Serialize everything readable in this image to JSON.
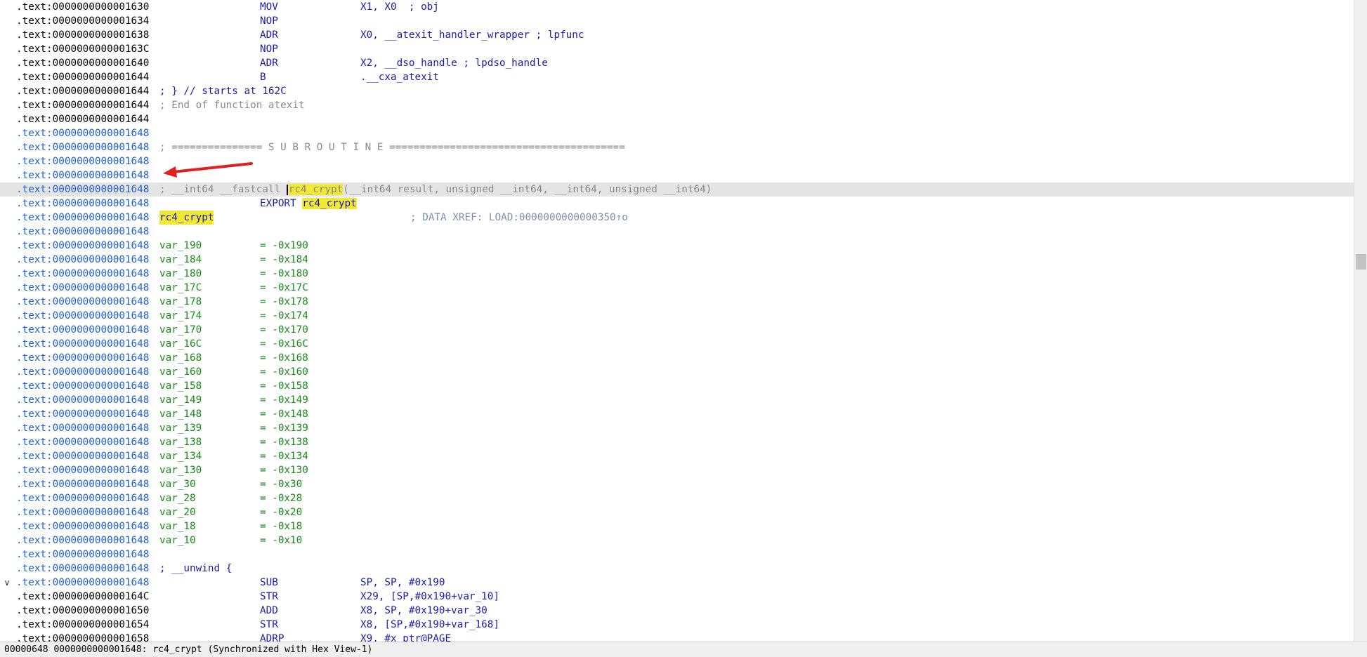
{
  "colors": {
    "background": "#ffffff",
    "address_black": "#000000",
    "address_blue": "#1f5fd6",
    "mnemonic": "#1b1bb0",
    "comment": "#8a8a8a",
    "variable": "#1a8a1a",
    "highlight": "#f0e832",
    "current_line": "#e4e4e4",
    "arrow": "#e02020"
  },
  "disasm": {
    "lines": [
      {
        "addr": ".text:0000000000001630",
        "addr_color": "black",
        "mnem": "MOV",
        "ops": "X1, X0  ; obj"
      },
      {
        "addr": ".text:0000000000001634",
        "addr_color": "black",
        "mnem": "NOP",
        "ops": ""
      },
      {
        "addr": ".text:0000000000001638",
        "addr_color": "black",
        "mnem": "ADR",
        "ops": "X0, __atexit_handler_wrapper ; lpfunc"
      },
      {
        "addr": ".text:000000000000163C",
        "addr_color": "black",
        "mnem": "NOP",
        "ops": ""
      },
      {
        "addr": ".text:0000000000001640",
        "addr_color": "black",
        "mnem": "ADR",
        "ops": "X2, __dso_handle ; lpdso_handle"
      },
      {
        "addr": ".text:0000000000001644",
        "addr_color": "black",
        "mnem": "B",
        "ops": ".__cxa_atexit"
      },
      {
        "addr": ".text:0000000000001644",
        "addr_color": "black",
        "comment_blue": "; } // starts at 162C"
      },
      {
        "addr": ".text:0000000000001644",
        "addr_color": "black",
        "comment": "; End of function atexit"
      },
      {
        "addr": ".text:0000000000001644",
        "addr_color": "black"
      },
      {
        "addr": ".text:0000000000001648",
        "addr_color": "blue"
      },
      {
        "addr": ".text:0000000000001648",
        "addr_color": "blue",
        "comment": "; =============== S U B R O U T I N E ======================================="
      },
      {
        "addr": ".text:0000000000001648",
        "addr_color": "blue"
      },
      {
        "addr": ".text:0000000000001648",
        "addr_color": "blue"
      },
      {
        "addr": ".text:0000000000001648",
        "addr_color": "blue",
        "proto_pre": "; __int64 __fastcall ",
        "proto_name": "rc4_crypt",
        "proto_post": "(__int64 result, unsigned __int64, __int64, unsigned __int64)",
        "current": true
      },
      {
        "addr": ".text:0000000000001648",
        "addr_color": "blue",
        "mnem": "EXPORT",
        "export_name": "rc4_crypt"
      },
      {
        "addr": ".text:0000000000001648",
        "addr_color": "blue",
        "label": "rc4_crypt",
        "xref": "; DATA XREF: LOAD:0000000000000350↑o"
      },
      {
        "addr": ".text:0000000000001648",
        "addr_color": "blue"
      },
      {
        "addr": ".text:0000000000001648",
        "addr_color": "blue",
        "var": "var_190",
        "val": "= -0x190"
      },
      {
        "addr": ".text:0000000000001648",
        "addr_color": "blue",
        "var": "var_184",
        "val": "= -0x184"
      },
      {
        "addr": ".text:0000000000001648",
        "addr_color": "blue",
        "var": "var_180",
        "val": "= -0x180"
      },
      {
        "addr": ".text:0000000000001648",
        "addr_color": "blue",
        "var": "var_17C",
        "val": "= -0x17C"
      },
      {
        "addr": ".text:0000000000001648",
        "addr_color": "blue",
        "var": "var_178",
        "val": "= -0x178"
      },
      {
        "addr": ".text:0000000000001648",
        "addr_color": "blue",
        "var": "var_174",
        "val": "= -0x174"
      },
      {
        "addr": ".text:0000000000001648",
        "addr_color": "blue",
        "var": "var_170",
        "val": "= -0x170"
      },
      {
        "addr": ".text:0000000000001648",
        "addr_color": "blue",
        "var": "var_16C",
        "val": "= -0x16C"
      },
      {
        "addr": ".text:0000000000001648",
        "addr_color": "blue",
        "var": "var_168",
        "val": "= -0x168"
      },
      {
        "addr": ".text:0000000000001648",
        "addr_color": "blue",
        "var": "var_160",
        "val": "= -0x160"
      },
      {
        "addr": ".text:0000000000001648",
        "addr_color": "blue",
        "var": "var_158",
        "val": "= -0x158"
      },
      {
        "addr": ".text:0000000000001648",
        "addr_color": "blue",
        "var": "var_149",
        "val": "= -0x149"
      },
      {
        "addr": ".text:0000000000001648",
        "addr_color": "blue",
        "var": "var_148",
        "val": "= -0x148"
      },
      {
        "addr": ".text:0000000000001648",
        "addr_color": "blue",
        "var": "var_139",
        "val": "= -0x139"
      },
      {
        "addr": ".text:0000000000001648",
        "addr_color": "blue",
        "var": "var_138",
        "val": "= -0x138"
      },
      {
        "addr": ".text:0000000000001648",
        "addr_color": "blue",
        "var": "var_134",
        "val": "= -0x134"
      },
      {
        "addr": ".text:0000000000001648",
        "addr_color": "blue",
        "var": "var_130",
        "val": "= -0x130"
      },
      {
        "addr": ".text:0000000000001648",
        "addr_color": "blue",
        "var": "var_30",
        "val": "= -0x30"
      },
      {
        "addr": ".text:0000000000001648",
        "addr_color": "blue",
        "var": "var_28",
        "val": "= -0x28"
      },
      {
        "addr": ".text:0000000000001648",
        "addr_color": "blue",
        "var": "var_20",
        "val": "= -0x20"
      },
      {
        "addr": ".text:0000000000001648",
        "addr_color": "blue",
        "var": "var_18",
        "val": "= -0x18"
      },
      {
        "addr": ".text:0000000000001648",
        "addr_color": "blue",
        "var": "var_10",
        "val": "= -0x10"
      },
      {
        "addr": ".text:0000000000001648",
        "addr_color": "blue"
      },
      {
        "addr": ".text:0000000000001648",
        "addr_color": "blue",
        "comment_blue": "; __unwind {"
      },
      {
        "addr": ".text:0000000000001648",
        "addr_color": "blue",
        "mnem": "SUB",
        "ops": "SP, SP, #0x190",
        "gutter": "∨"
      },
      {
        "addr": ".text:000000000000164C",
        "addr_color": "black",
        "mnem": "STR",
        "ops": "X29, [SP,#0x190+var_10]"
      },
      {
        "addr": ".text:0000000000001650",
        "addr_color": "black",
        "mnem": "ADD",
        "ops": "X8, SP, #0x190+var_30"
      },
      {
        "addr": ".text:0000000000001654",
        "addr_color": "black",
        "mnem": "STR",
        "ops": "X8, [SP,#0x190+var_168]"
      },
      {
        "addr": ".text:0000000000001658",
        "addr_color": "black",
        "mnem": "ADRP",
        "ops": "X9, #x_ptr@PAGE"
      }
    ]
  },
  "status": {
    "text": "00000648 0000000000001648: rc4_crypt (Synchronized with Hex View-1)"
  }
}
